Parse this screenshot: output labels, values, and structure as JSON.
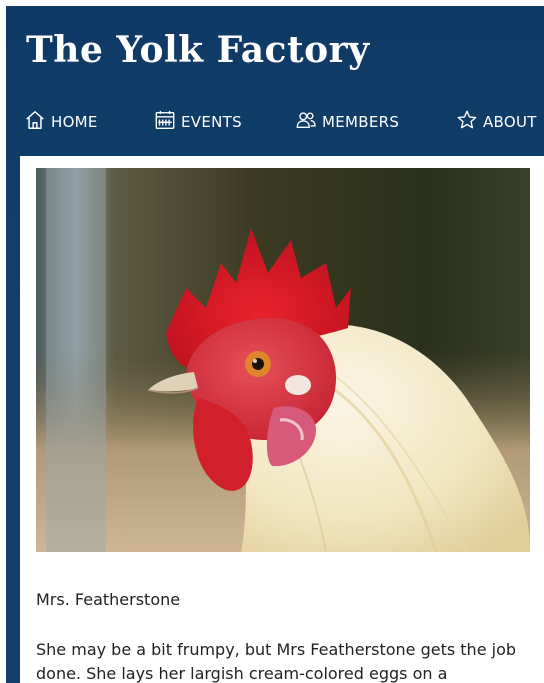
{
  "header": {
    "title": "The Yolk Factory"
  },
  "nav": {
    "items": [
      {
        "label": "HOME",
        "icon": "home-icon"
      },
      {
        "label": "EVENTS",
        "icon": "calendar-icon"
      },
      {
        "label": "MEMBERS",
        "icon": "users-icon"
      },
      {
        "label": "ABOUT",
        "icon": "star-icon"
      }
    ]
  },
  "content": {
    "image_name": "rooster-photo",
    "caption": "Mrs. Featherstone",
    "description": "She may be a bit frumpy, but Mrs Featherstone gets the job done. She lays her largish cream-colored eggs on a"
  },
  "colors": {
    "header_bg": "#123f6c",
    "card_bg": "#ffffff",
    "text": "#222222",
    "nav_text": "#ffffff"
  }
}
